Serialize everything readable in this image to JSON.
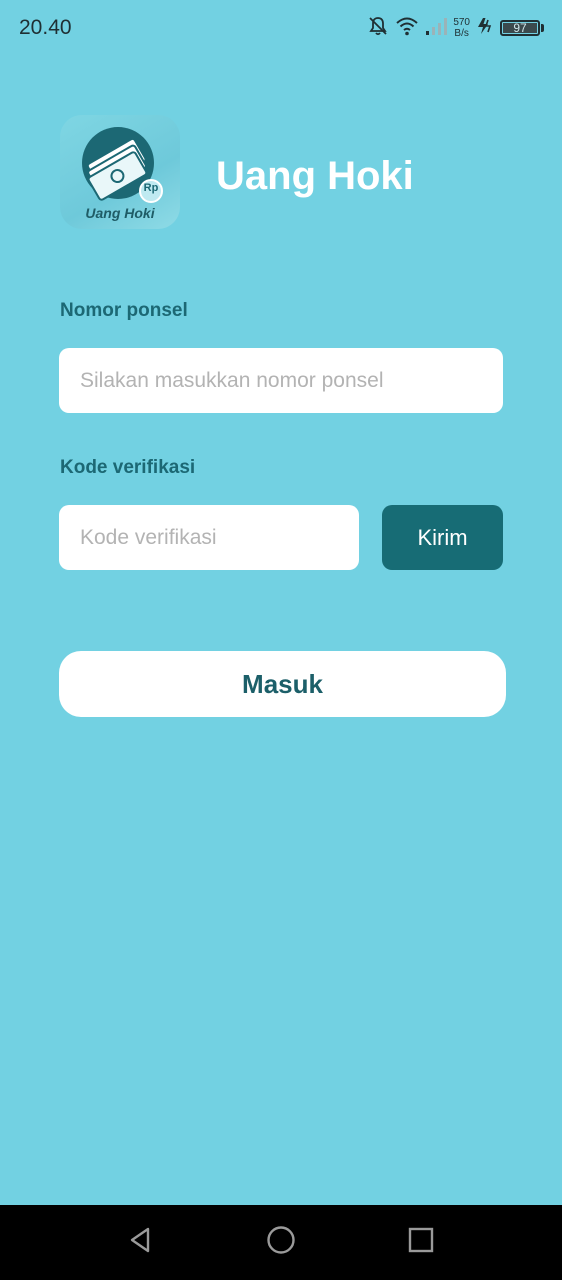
{
  "status_bar": {
    "time": "20.40",
    "net_speed_value": "570",
    "net_speed_unit": "B/s",
    "battery": "97",
    "icons": [
      "notifications-off-icon",
      "wifi-icon",
      "signal-icon",
      "charging-icon",
      "battery-icon"
    ]
  },
  "header": {
    "logo_text": "Uang Hoki",
    "logo_badge": "Rp",
    "title": "Uang Hoki"
  },
  "form": {
    "phone_label": "Nomor ponsel",
    "phone_placeholder": "Silakan masukkan nomor ponsel",
    "phone_value": "",
    "code_label": "Kode verifikasi",
    "code_placeholder": "Kode verifikasi",
    "code_value": "",
    "send_button": "Kirim",
    "login_button": "Masuk"
  },
  "nav_bar": {
    "buttons": [
      "back-icon",
      "home-icon",
      "recents-icon"
    ]
  },
  "colors": {
    "background": "#72d1e2",
    "accent_dark": "#176c75",
    "label_text": "#1c6874",
    "title_text": "#ffffff"
  }
}
